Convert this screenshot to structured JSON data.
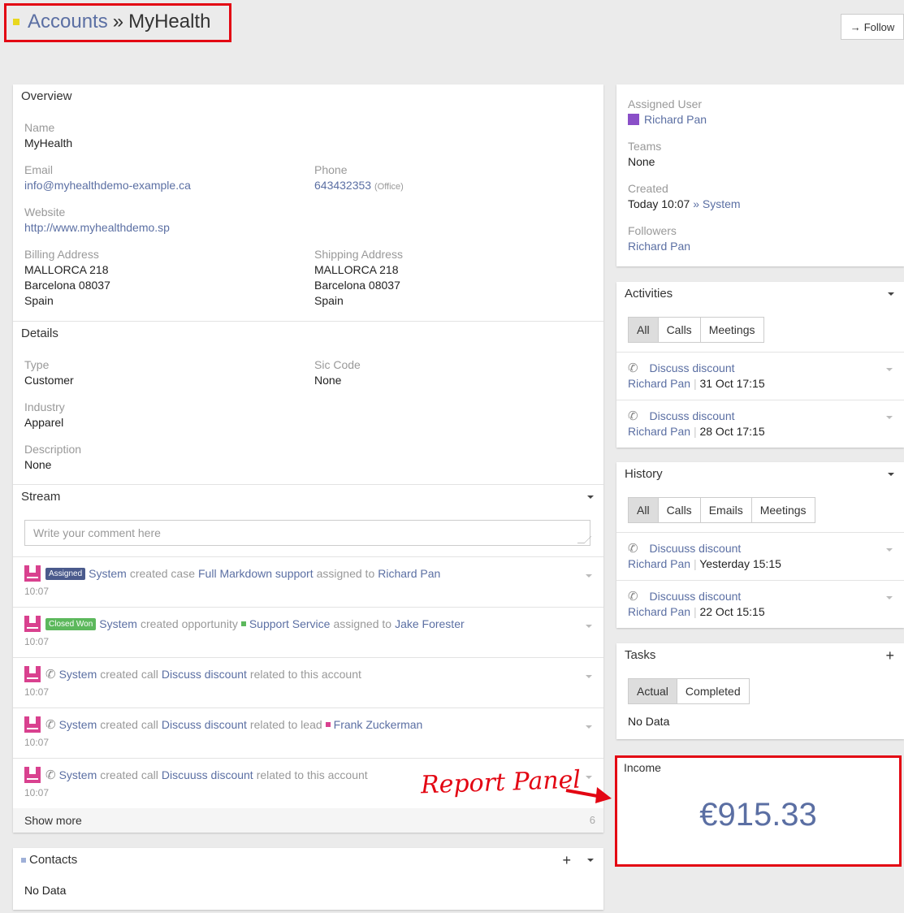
{
  "header": {
    "parent": "Accounts",
    "separator": "»",
    "title": "MyHealth",
    "follow_label": "Follow",
    "follow_icon": "arrow-right-icon"
  },
  "overview": {
    "title": "Overview",
    "name_label": "Name",
    "name": "MyHealth",
    "email_label": "Email",
    "email": "info@myhealthdemo-example.ca",
    "phone_label": "Phone",
    "phone": "643432353",
    "phone_type": "(Office)",
    "website_label": "Website",
    "website": "http://www.myhealthdemo.sp",
    "billing_label": "Billing Address",
    "billing": [
      "MALLORCA 218",
      "Barcelona 08037",
      "Spain"
    ],
    "shipping_label": "Shipping Address",
    "shipping": [
      "MALLORCA 218",
      "Barcelona 08037",
      "Spain"
    ]
  },
  "details": {
    "title": "Details",
    "type_label": "Type",
    "type": "Customer",
    "sic_label": "Sic Code",
    "sic": "None",
    "industry_label": "Industry",
    "industry": "Apparel",
    "description_label": "Description",
    "description": "None"
  },
  "stream": {
    "title": "Stream",
    "placeholder": "Write your comment here",
    "items": [
      {
        "time": "10:07",
        "badge": "Assigned",
        "badge_color": "#4a5a8c",
        "parts": [
          "System",
          "created case",
          "Full Markdown support",
          "assigned to",
          "Richard Pan"
        ]
      },
      {
        "time": "10:07",
        "badge": "Closed Won",
        "badge_color": "#5cb85c",
        "parts": [
          "System",
          "created opportunity",
          "Support Service",
          "assigned to",
          "Jake Forester"
        ]
      },
      {
        "time": "10:07",
        "parts": [
          "System",
          "created call",
          "Discuss discount",
          "related to this account"
        ]
      },
      {
        "time": "10:07",
        "parts": [
          "System",
          "created call",
          "Discuss discount",
          "related to lead",
          "Frank Zuckerman"
        ]
      },
      {
        "time": "10:07",
        "parts": [
          "System",
          "created call",
          "Discuuss discount",
          "related to this account"
        ]
      }
    ],
    "show_more": "Show more",
    "remaining_count": "6"
  },
  "contacts": {
    "title": "Contacts",
    "empty": "No Data"
  },
  "side": {
    "assigned_user_label": "Assigned User",
    "assigned_user": "Richard Pan",
    "teams_label": "Teams",
    "teams": "None",
    "created_label": "Created",
    "created": "Today 10:07",
    "created_by": "» System",
    "followers_label": "Followers",
    "followers": "Richard Pan"
  },
  "activities": {
    "title": "Activities",
    "tabs": [
      "All",
      "Calls",
      "Meetings"
    ],
    "items": [
      {
        "name": "Discuss discount",
        "user": "Richard Pan",
        "date": "31 Oct 17:15"
      },
      {
        "name": "Discuss discount",
        "user": "Richard Pan",
        "date": "28 Oct 17:15"
      }
    ]
  },
  "history": {
    "title": "History",
    "tabs": [
      "All",
      "Calls",
      "Emails",
      "Meetings"
    ],
    "items": [
      {
        "name": "Discuuss discount",
        "user": "Richard Pan",
        "date": "Yesterday 15:15"
      },
      {
        "name": "Discuuss discount",
        "user": "Richard Pan",
        "date": "22 Oct 15:15"
      }
    ]
  },
  "tasks": {
    "title": "Tasks",
    "tabs": [
      "Actual",
      "Completed"
    ],
    "empty": "No Data"
  },
  "income": {
    "title": "Income",
    "value": "€915.33"
  },
  "annotation": {
    "text": "Report Panel"
  },
  "colors": {
    "link": "#5b6fa3",
    "highlight": "#e30613",
    "avatar": "#d9418f",
    "title_square": "#e8d71e"
  }
}
